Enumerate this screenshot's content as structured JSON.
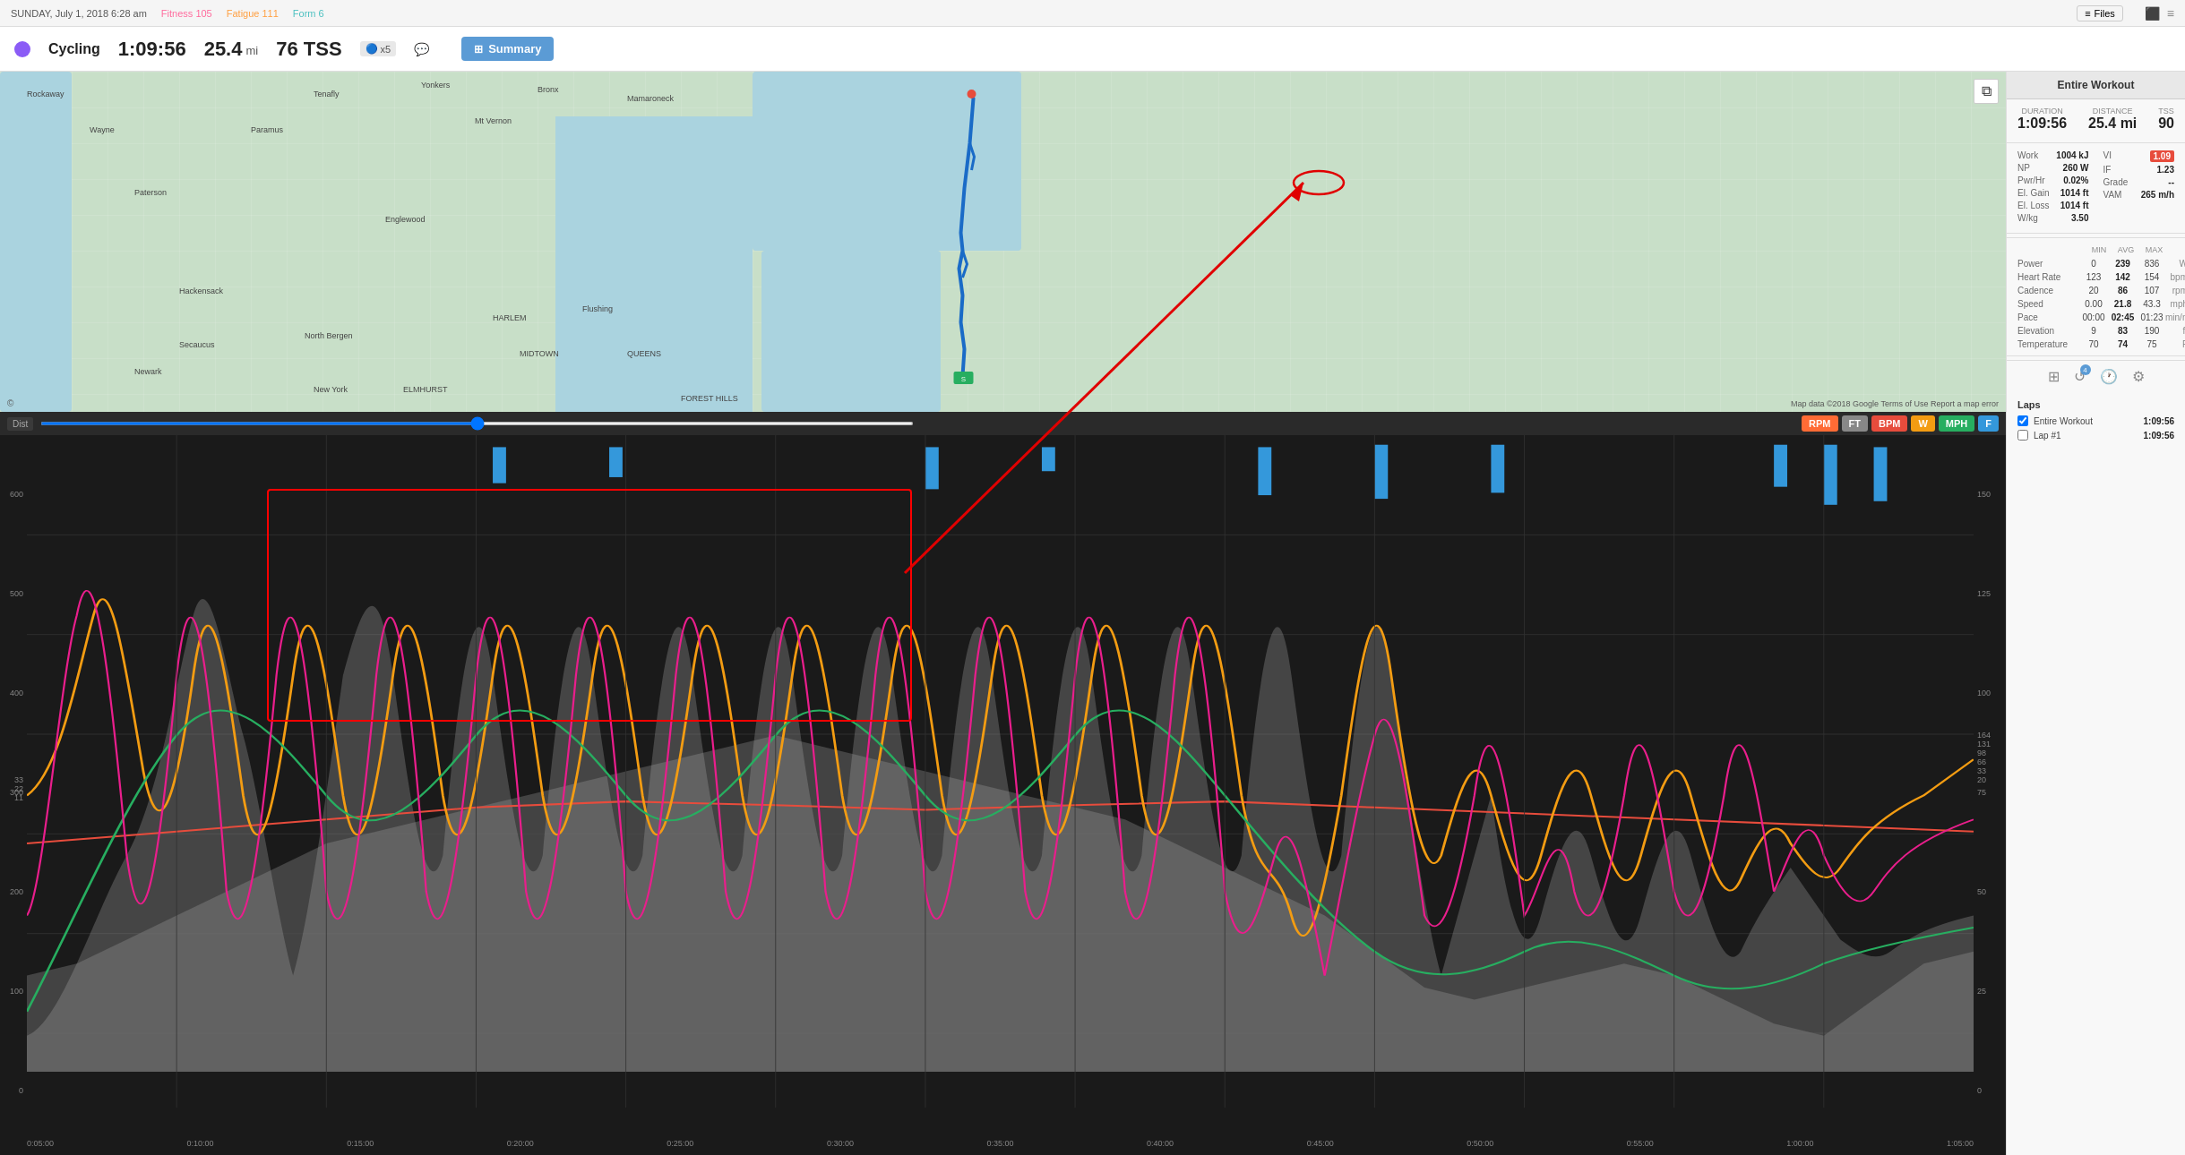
{
  "app": {
    "title": "Cycling"
  },
  "topbar": {
    "date": "SUNDAY, July 1, 2018  6:28 am",
    "fitness_label": "Fitness",
    "fitness_value": "105",
    "fatigue_label": "Fatigue",
    "fatigue_value": "111",
    "form_label": "Form",
    "form_value": "6",
    "files_btn": "Files"
  },
  "activity": {
    "duration": "1:09:56",
    "distance": "25.4",
    "distance_unit": "mi",
    "tss": "76 TSS",
    "badge_x5": "x5",
    "summary_btn": "Summary"
  },
  "map": {
    "attribution": "Map data ©2018 Google  Terms of Use  Report a map error"
  },
  "right_panel": {
    "header": "Entire Workout",
    "duration_label": "Duration",
    "duration_value": "1:09:56",
    "distance_label": "Distance",
    "distance_value": "25.4 mi",
    "tss_label": "TSS",
    "tss_value": "90",
    "metrics": [
      {
        "name": "Work",
        "value": "1004 kJ"
      },
      {
        "name": "NP",
        "value": "260 W"
      },
      {
        "name": "Pwr/Hr",
        "value": "0.02%"
      },
      {
        "name": "El. Gain",
        "value": "1014 ft"
      },
      {
        "name": "El. Loss",
        "value": "1014 ft"
      },
      {
        "name": "W/kg",
        "value": "3.50"
      }
    ],
    "metrics_right": [
      {
        "name": "VI",
        "value": "1.09"
      },
      {
        "name": "IF",
        "value": "1.23"
      },
      {
        "name": "Grade",
        "value": "--"
      },
      {
        "name": "VAM",
        "value": "265 m/h"
      }
    ],
    "min_avg_max_label": [
      "MIN",
      "AVG",
      "MAX"
    ],
    "stats_rows": [
      {
        "label": "Power",
        "min": "0",
        "avg": "239",
        "max": "836",
        "unit": "W"
      },
      {
        "label": "Heart Rate",
        "min": "123",
        "avg": "142",
        "max": "154",
        "unit": "bpm"
      },
      {
        "label": "Cadence",
        "min": "20",
        "avg": "86",
        "max": "107",
        "unit": "rpm"
      },
      {
        "label": "Speed",
        "min": "0.00",
        "avg": "21.8",
        "max": "43.3",
        "unit": "mph"
      },
      {
        "label": "Pace",
        "min": "00:00",
        "avg": "02:45",
        "max": "01:23",
        "unit": "min/mi"
      },
      {
        "label": "Elevation",
        "min": "9",
        "avg": "83",
        "max": "190",
        "unit": "ft"
      },
      {
        "label": "Temperature",
        "min": "70",
        "avg": "74",
        "max": "75",
        "unit": "F"
      }
    ],
    "laps_header": "Laps",
    "laps": [
      {
        "name": "Entire Workout",
        "time": "1:09:56"
      },
      {
        "name": "Lap #1",
        "time": "1:09:56"
      }
    ]
  },
  "chart": {
    "metric_btns": [
      "RPM",
      "FT",
      "BPM",
      "W",
      "MPH",
      "F"
    ],
    "y_labels_left": [
      "600",
      "500",
      "400",
      "300",
      "200",
      "100",
      "0"
    ],
    "y_labels_left2": [
      "33",
      "22",
      "11"
    ],
    "y_labels_right": [
      "150",
      "125",
      "100",
      "75",
      "50",
      "25",
      "0"
    ],
    "y_labels_right2": [
      "164",
      "131",
      "98",
      "66",
      "33",
      "20"
    ],
    "x_labels": [
      "0:05:00",
      "0:10:00",
      "0:15:00",
      "0:20:00",
      "0:25:00",
      "0:30:00",
      "0:35:00",
      "0:40:00",
      "0:45:00",
      "0:50:00",
      "0:55:00",
      "1:00:00",
      "1:05:00"
    ],
    "axis_label": "Dist"
  },
  "vi_highlight": {
    "value": "1.09"
  }
}
